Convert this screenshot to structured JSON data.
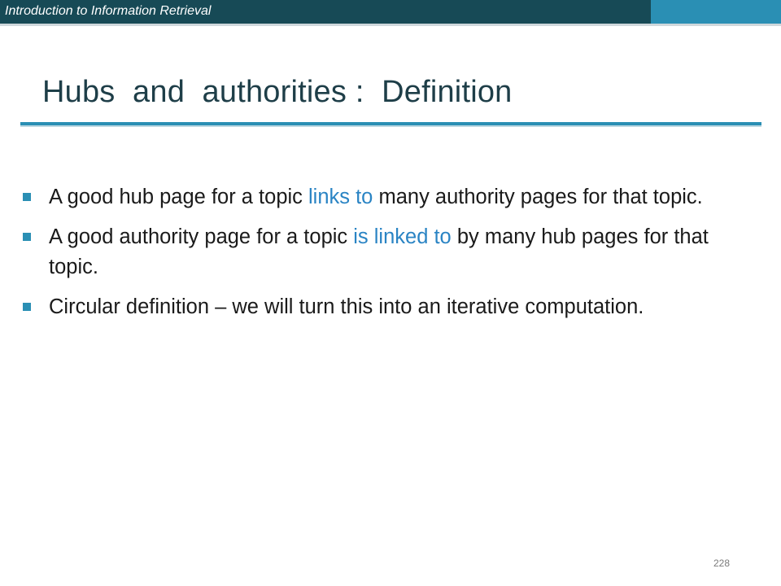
{
  "header": {
    "course_title": "Introduction to Information Retrieval"
  },
  "slide": {
    "title": "Hubs  and  authorities :  Definition",
    "bullets": [
      {
        "before": "A good hub page for a topic ",
        "highlight": "links to",
        "after": " many authority pages for that topic."
      },
      {
        "before": "A good authority page for a topic ",
        "highlight": "is linked to",
        "after": " by many hub pages for that topic."
      },
      {
        "before": "Circular definition – we will turn this into an iterative computation.",
        "highlight": "",
        "after": ""
      }
    ],
    "page_number": "228"
  },
  "colors": {
    "header_dark": "#174a56",
    "header_accent": "#2a8fb4",
    "title_text": "#1e3e48",
    "highlight_text": "#2a84c4",
    "bullet_marker": "#2a8fb4"
  }
}
